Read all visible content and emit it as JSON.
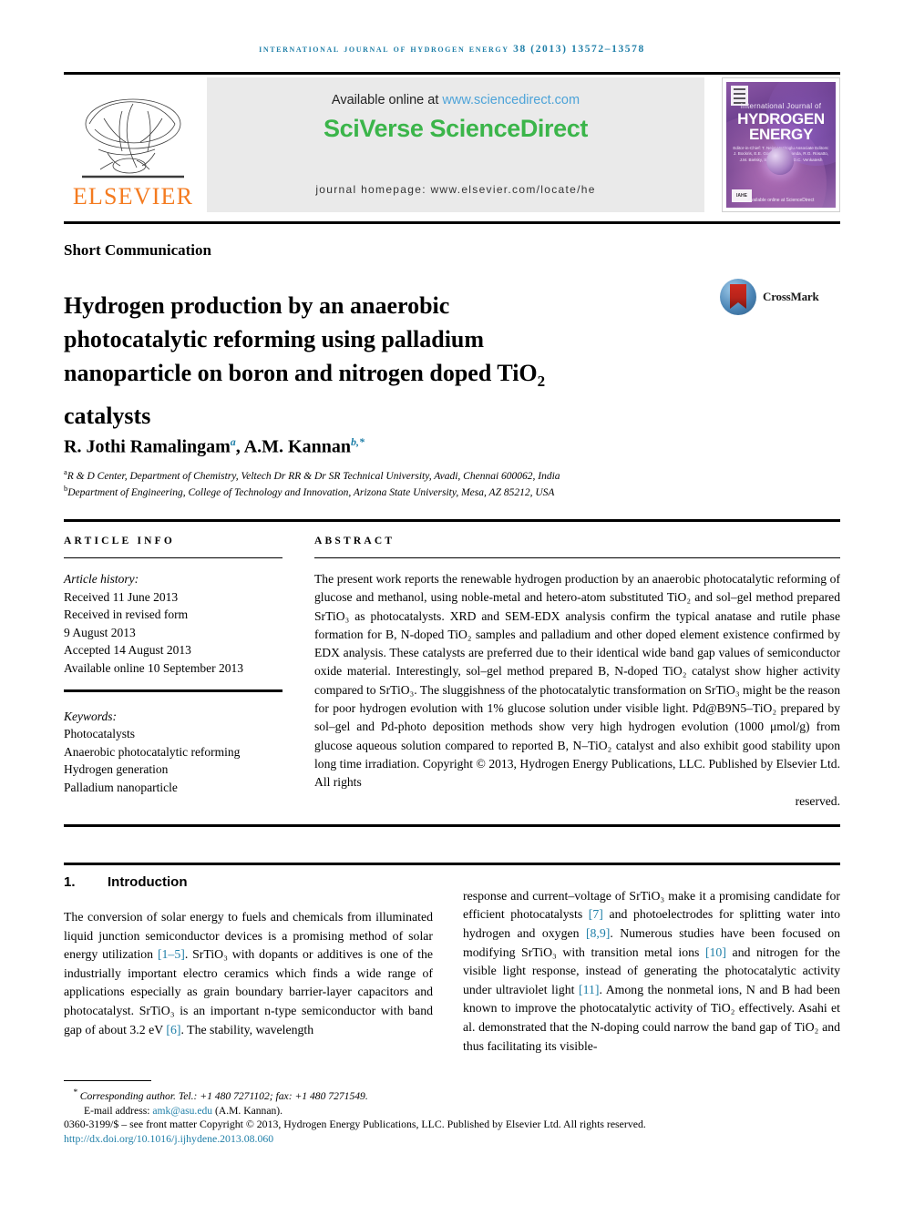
{
  "running_head": "International Journal of Hydrogen Energy 38 (2013) 13572–13578",
  "masthead": {
    "publisher_name": "ELSEVIER",
    "available_prefix": "Available online at ",
    "available_url": "www.sciencedirect.com",
    "sciencedirect_logo": "SciVerse ScienceDirect",
    "journal_homepage": "journal homepage: www.elsevier.com/locate/he",
    "cover": {
      "line1": "International Journal of",
      "line2": "HYDROGEN",
      "line3": "ENERGY",
      "editors": "Editor-in-Chief: T. Nejat Veziroglu    Associate Editors: J. Bockris, E.E. Gonlaz, D.N. Lianda, R.G. Rosatto, J.M. Bielsky, S.A. Sherif and D.C. Venkatesh",
      "bottom_text": "Available online at ScienceDirect",
      "badge": "IAHE"
    }
  },
  "article_type": "Short Communication",
  "title": {
    "line1": "Hydrogen production by an anaerobic",
    "line2": "photocatalytic reforming using palladium",
    "line3_pre": "nanoparticle on boron and nitrogen doped TiO",
    "line3_sub": "2",
    "line4": "catalysts"
  },
  "crossmark": {
    "label": "CrossMark"
  },
  "authors": {
    "name1": "R. Jothi Ramalingam",
    "mark1": "a",
    "separator": ", ",
    "name2": "A.M. Kannan",
    "mark2": "b,*"
  },
  "affiliations": [
    {
      "mark": "a",
      "text": "R & D Center, Department of Chemistry, Veltech Dr RR & Dr SR Technical University, Avadi, Chennai 600062, India"
    },
    {
      "mark": "b",
      "text": "Department of Engineering, College of Technology and Innovation, Arizona State University, Mesa, AZ 85212, USA"
    }
  ],
  "article_info": {
    "heading": "ARTICLE INFO",
    "history_label": "Article history:",
    "history": [
      "Received 11 June 2013",
      "Received in revised form",
      "9 August 2013",
      "Accepted 14 August 2013",
      "Available online 10 September 2013"
    ],
    "keywords_label": "Keywords:",
    "keywords": [
      "Photocatalysts",
      "Anaerobic photocatalytic reforming",
      "Hydrogen generation",
      "Palladium nanoparticle"
    ]
  },
  "abstract": {
    "heading": "ABSTRACT",
    "body": "The present work reports the renewable hydrogen production by an anaerobic photocatalytic reforming of glucose and methanol, using noble-metal and hetero-atom substituted TiO₂ and sol–gel method prepared SrTiO₃ as photocatalysts. XRD and SEM-EDX analysis confirm the typical anatase and rutile phase formation for B, N-doped TiO₂ samples and palladium and other doped element existence confirmed by EDX analysis. These catalysts are preferred due to their identical wide band gap values of semiconductor oxide material. Interestingly, sol–gel method prepared B, N-doped TiO₂ catalyst show higher activity compared to SrTiO₃. The sluggishness of the photocatalytic transformation on SrTiO₃ might be the reason for poor hydrogen evolution with 1% glucose solution under visible light. Pd@B9N5–TiO₂ prepared by sol–gel and Pd-photo deposition methods show very high hydrogen evolution (1000 μmol/g) from glucose aqueous solution compared to reported B, N–TiO₂ catalyst and also exhibit good stability upon long time irradiation.",
    "copyright": "Copyright © 2013, Hydrogen Energy Publications, LLC. Published by Elsevier Ltd. All rights",
    "copyright_last": "reserved."
  },
  "introduction": {
    "number": "1.",
    "heading": "Introduction",
    "left_paragraph_pre": "The conversion of solar energy to fuels and chemicals from illuminated liquid junction semiconductor devices is a promising method of solar energy utilization ",
    "ref1": "[1–5]",
    "left_paragraph_mid": ". SrTiO₃ with dopants or additives is one of the industrially important electro ceramics which finds a wide range of applications especially as grain boundary barrier-layer capacitors and photocatalyst. SrTiO₃ is an important n-type semiconductor with band gap of about 3.2 eV ",
    "ref6": "[6]",
    "left_paragraph_end": ". The stability, wavelength",
    "right_pre": "response and current–voltage of SrTiO₃ make it a promising candidate for efficient photocatalysts ",
    "ref7": "[7]",
    "right_mid1": " and photoelectrodes for splitting water into hydrogen and oxygen ",
    "ref89": "[8,9]",
    "right_mid2": ". Numerous studies have been focused on modifying SrTiO₃ with transition metal ions ",
    "ref10": "[10]",
    "right_mid3": " and nitrogen for the visible light response, instead of generating the photocatalytic activity under ultraviolet light ",
    "ref11": "[11]",
    "right_end": ". Among the nonmetal ions, N and B had been known to improve the photocatalytic activity of TiO₂ effectively. Asahi et al. demonstrated that the N-doping could narrow the band gap of TiO₂ and thus facilitating its visible-"
  },
  "footer": {
    "corresponding_mark": "*",
    "corresponding": "Corresponding author. Tel.: +1 480 7271102; fax: +1 480 7271549.",
    "email_label": "E-mail address: ",
    "email": "amk@asu.edu",
    "email_suffix": " (A.M. Kannan).",
    "issn_line": "0360-3199/$ – see front matter Copyright © 2013, Hydrogen Energy Publications, LLC. Published by Elsevier Ltd. All rights reserved.",
    "doi": "http://dx.doi.org/10.1016/j.ijhydene.2013.08.060"
  },
  "colors": {
    "link_blue": "#1f7fa8",
    "sciencedirect_green": "#3bb54a",
    "elsevier_orange": "#f47b20",
    "url_blue": "#4da3d8"
  }
}
